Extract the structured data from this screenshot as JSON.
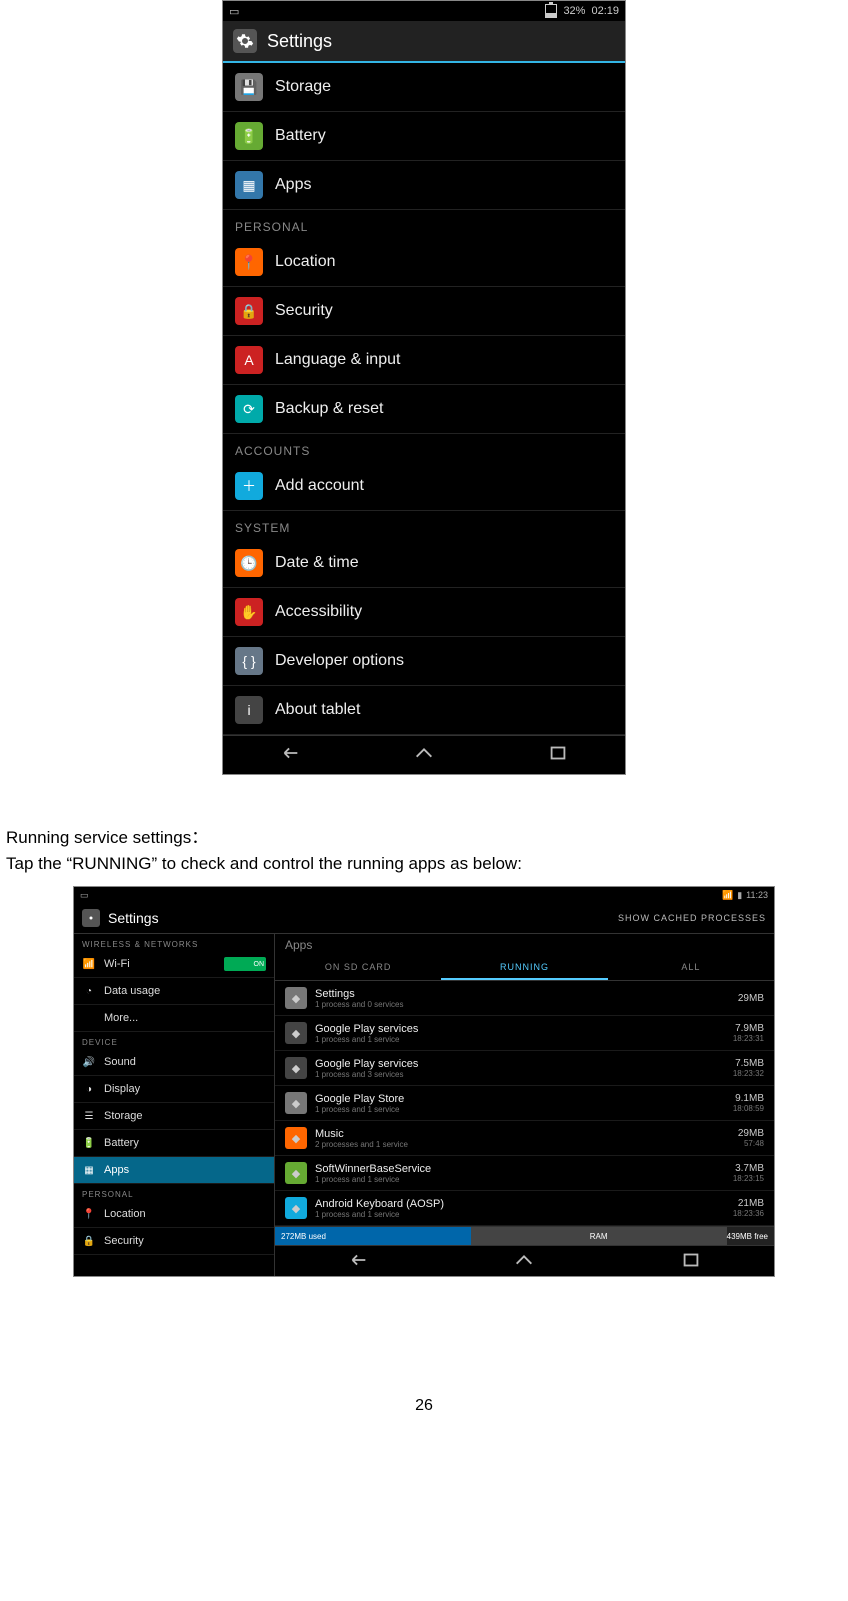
{
  "page_number": "26",
  "body_text": {
    "line1": "Running service settings：",
    "line2": "Tap the “RUNNING” to check and control the running apps as below:"
  },
  "screenshot1": {
    "status": {
      "battery_pct": "32%",
      "time": "02:19"
    },
    "title": "Settings",
    "items": [
      {
        "label": "Storage",
        "icon": "storage-icon",
        "color": "bg-grey"
      },
      {
        "label": "Battery",
        "icon": "battery-icon",
        "color": "bg-green"
      },
      {
        "label": "Apps",
        "icon": "apps-icon",
        "color": "bg-blue"
      }
    ],
    "section_personal": "PERSONAL",
    "personal": [
      {
        "label": "Location",
        "icon": "location-icon",
        "color": "bg-orange"
      },
      {
        "label": "Security",
        "icon": "security-icon",
        "color": "bg-red"
      },
      {
        "label": "Language & input",
        "icon": "language-icon",
        "color": "bg-red"
      },
      {
        "label": "Backup & reset",
        "icon": "backup-icon",
        "color": "bg-teal"
      }
    ],
    "section_accounts": "ACCOUNTS",
    "accounts": [
      {
        "label": "Add account",
        "icon": "add-icon",
        "color": "bg-cyan"
      }
    ],
    "section_system": "SYSTEM",
    "system": [
      {
        "label": "Date & time",
        "icon": "date-icon",
        "color": "bg-orange"
      },
      {
        "label": "Accessibility",
        "icon": "accessibility-icon",
        "color": "bg-red"
      },
      {
        "label": "Developer options",
        "icon": "developer-icon",
        "color": "bg-slate"
      },
      {
        "label": "About tablet",
        "icon": "about-icon",
        "color": "bg-dark"
      }
    ]
  },
  "screenshot2": {
    "status": {
      "battery_pct": "",
      "time": "11:23"
    },
    "title": "Settings",
    "header_action": "SHOW CACHED PROCESSES",
    "sidebar": {
      "section_wireless": "WIRELESS & NETWORKS",
      "wifi": {
        "label": "Wi-Fi",
        "toggle": "ON"
      },
      "data_usage": "Data usage",
      "more": "More...",
      "section_device": "DEVICE",
      "device_items": [
        "Sound",
        "Display",
        "Storage",
        "Battery",
        "Apps"
      ],
      "section_personal": "PERSONAL",
      "personal_items": [
        "Location",
        "Security"
      ]
    },
    "main_header": "Apps",
    "tabs": {
      "sd": "ON SD CARD",
      "running": "RUNNING",
      "all": "ALL"
    },
    "apps": [
      {
        "name": "Settings",
        "sub": "1 process and 0 services",
        "size": "29MB",
        "time": "",
        "icon_bg": "bg-grey"
      },
      {
        "name": "Google Play services",
        "sub": "1 process and 1 service",
        "size": "7.9MB",
        "time": "18:23:31",
        "icon_bg": "bg-dark"
      },
      {
        "name": "Google Play services",
        "sub": "1 process and 3 services",
        "size": "7.5MB",
        "time": "18:23:32",
        "icon_bg": "bg-dark"
      },
      {
        "name": "Google Play Store",
        "sub": "1 process and 1 service",
        "size": "9.1MB",
        "time": "18:08:59",
        "icon_bg": "bg-grey"
      },
      {
        "name": "Music",
        "sub": "2 processes and 1 service",
        "size": "29MB",
        "time": "57:48",
        "icon_bg": "bg-orange"
      },
      {
        "name": "SoftWinnerBaseService",
        "sub": "1 process and 1 service",
        "size": "3.7MB",
        "time": "18:23:15",
        "icon_bg": "bg-green"
      },
      {
        "name": "Android Keyboard (AOSP)",
        "sub": "1 process and 1 service",
        "size": "21MB",
        "time": "18:23:36",
        "icon_bg": "bg-cyan"
      }
    ],
    "ram": {
      "used": "272MB used",
      "label": "RAM",
      "free": "439MB free",
      "used_pct": 38
    }
  }
}
